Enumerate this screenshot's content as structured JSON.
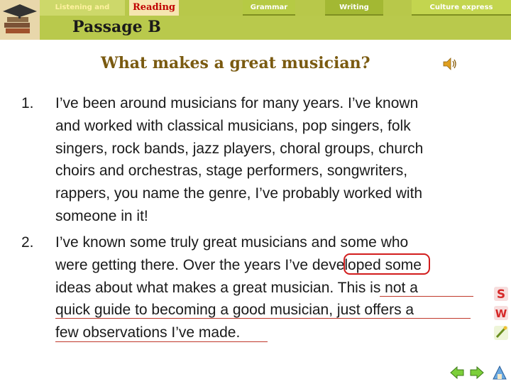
{
  "nav": {
    "listening": "Listening and speaking",
    "reading": "Reading",
    "grammar": "Grammar",
    "writing": "Writing",
    "culture": "Culture express"
  },
  "passage_label": "Passage B",
  "question": "What makes a great musician?",
  "paragraphs": [
    {
      "number": "1.",
      "lines": [
        "I’ve been around musicians for many years. I’ve known",
        "and worked with classical musicians, pop singers, folk",
        "singers, rock bands, jazz players, choral groups, church",
        "choirs and orchestras, stage performers, songwriters,",
        "rappers, you name the genre, I’ve probably worked with",
        "someone in it!"
      ]
    },
    {
      "number": "2.",
      "lines": [
        "I’ve known some truly great musicians and some who",
        "were getting there. Over the years I’ve developed some",
        "ideas about what makes a great musician. This is not a",
        "quick guide to becoming a good musician, just offers a",
        "few observations I’ve made."
      ]
    }
  ],
  "highlight_word": "developed",
  "icons": {
    "logo": "books-logo-icon",
    "audio": "speaker-icon",
    "side": [
      "s-icon",
      "w-icon",
      "brush-icon"
    ],
    "bottom": [
      "arrow-left-icon",
      "arrow-right-icon",
      "home-icon"
    ]
  },
  "colors": {
    "accent_olive": "#b9c94c",
    "reading_red": "#c00000",
    "question_brown": "#7a5a10",
    "highlight_red": "#d21d1d"
  }
}
